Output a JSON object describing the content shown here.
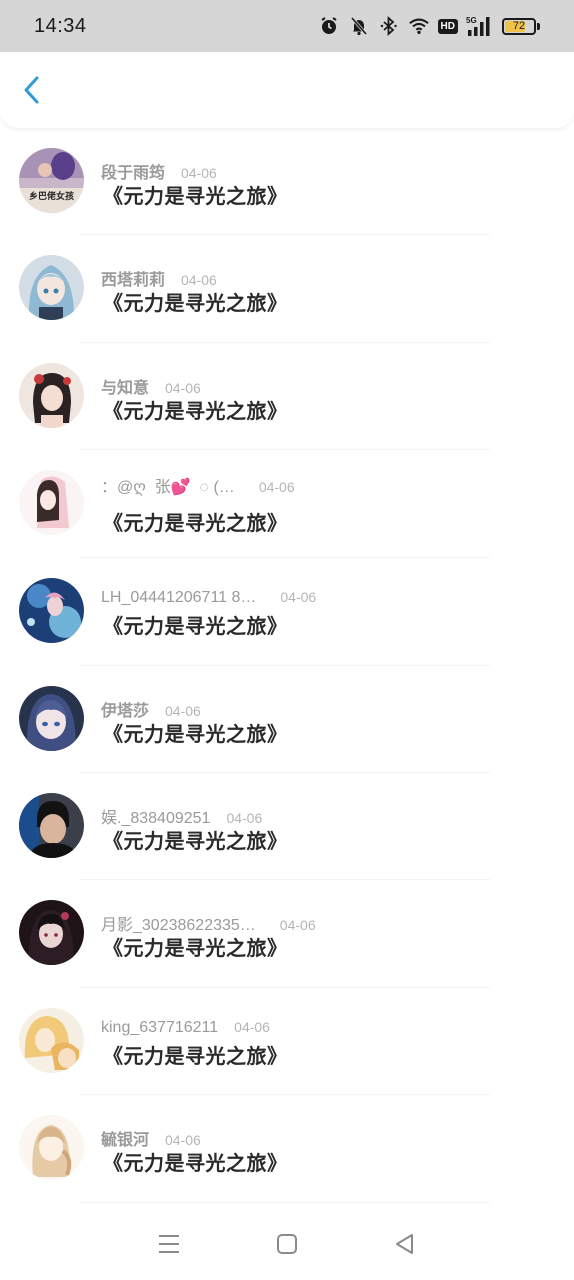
{
  "status_bar": {
    "time": "14:34",
    "hd_label": "HD",
    "network_label": "5G",
    "battery_level": "72",
    "icons": [
      "alarm-icon",
      "mute-icon",
      "bluetooth-icon",
      "wifi-icon",
      "hd-icon",
      "signal-5g-icon",
      "battery-icon"
    ]
  },
  "header": {
    "back_icon": "chevron-left-icon",
    "accent_color": "#2d9bd8"
  },
  "list": {
    "items": [
      {
        "username": "段于雨筠",
        "date": "04-06",
        "title": "《元力是寻光之旅》",
        "avatar_label": "乡巴佬女孩"
      },
      {
        "username": "西塔莉莉",
        "date": "04-06",
        "title": "《元力是寻光之旅》"
      },
      {
        "username": "与知意",
        "date": "04-06",
        "title": "《元力是寻光之旅》"
      },
      {
        "username": "：@ღ ︎ 张💕 ︎ ◌ (…",
        "date": "04-06",
        "title": "《元力是寻光之旅》"
      },
      {
        "username": "LH_04441206711 8…",
        "date": "04-06",
        "title": "《元力是寻光之旅》"
      },
      {
        "username": "伊塔莎",
        "date": "04-06",
        "title": "《元力是寻光之旅》"
      },
      {
        "username": "娱._838409251",
        "date": "04-06",
        "title": "《元力是寻光之旅》"
      },
      {
        "username": "月影_30238622335…",
        "date": "04-06",
        "title": "《元力是寻光之旅》"
      },
      {
        "username": "king_637716211",
        "date": "04-06",
        "title": "《元力是寻光之旅》"
      },
      {
        "username": "毓银河",
        "date": "04-06",
        "title": "《元力是寻光之旅》"
      }
    ]
  },
  "nav_bar": {
    "icons": [
      "menu-icon",
      "home-square-icon",
      "back-triangle-icon"
    ]
  }
}
